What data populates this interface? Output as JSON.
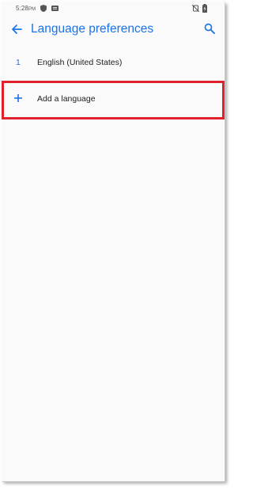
{
  "status_bar": {
    "time": "5:28",
    "ampm": "PM",
    "icons": [
      "shield-icon",
      "message-icon",
      "no-alarm-icon",
      "battery-icon"
    ]
  },
  "app_bar": {
    "title": "Language preferences",
    "back_icon": "arrow-left-icon",
    "search_icon": "search-icon"
  },
  "languages": [
    {
      "number": "1",
      "name": "English (United States)"
    }
  ],
  "add_language": {
    "label": "Add a language",
    "icon": "plus-icon"
  },
  "colors": {
    "accent": "#1a73e8",
    "highlight": "#e0202a",
    "background": "#fafafa",
    "text": "#202124"
  }
}
